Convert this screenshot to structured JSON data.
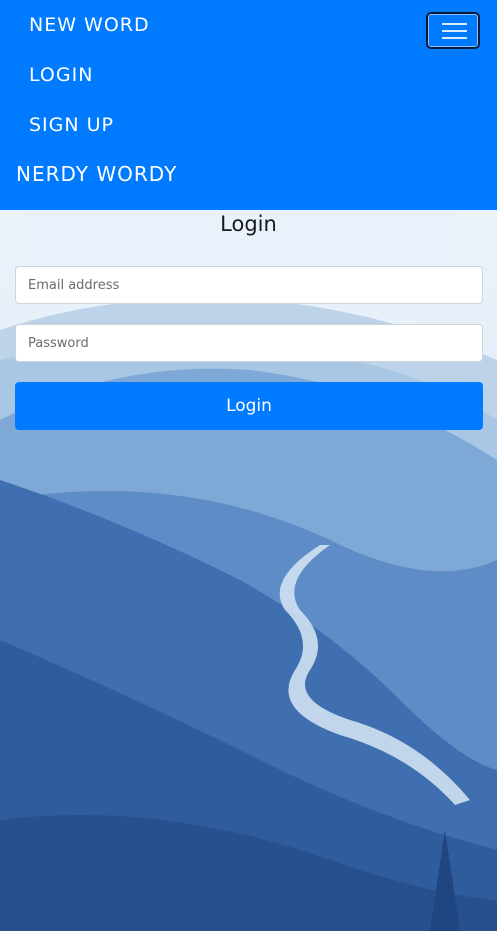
{
  "nav": {
    "links": [
      "NEW WORD",
      "LOGIN",
      "SIGN UP"
    ],
    "brand": "NERDY WORDY"
  },
  "form": {
    "title": "Login",
    "email_placeholder": "Email address",
    "password_placeholder": "Password",
    "submit_label": "Login"
  },
  "colors": {
    "navbar": "#007bff",
    "button": "#007bff"
  }
}
